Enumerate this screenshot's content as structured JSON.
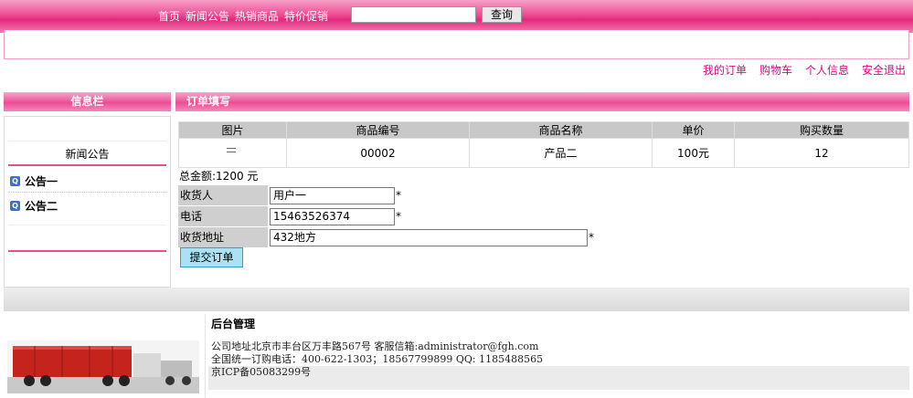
{
  "nav": {
    "items": [
      "首页",
      "新闻公告",
      "热销商品",
      "特价促销"
    ],
    "search_placeholder": "",
    "search_button": "查询"
  },
  "user_links": [
    "我的订单",
    "购物车",
    "个人信息",
    "安全退出"
  ],
  "sidebar": {
    "title": "信息栏",
    "news_tab": "新闻公告",
    "notices": [
      "公告一",
      "公告二"
    ]
  },
  "main": {
    "title": "订单填写",
    "table": {
      "headers": [
        "图片",
        "商品编号",
        "商品名称",
        "单价",
        "购买数量"
      ],
      "rows": [
        {
          "image": "",
          "code": "00002",
          "name": "产品二",
          "price": "100元",
          "qty": "12"
        }
      ]
    },
    "total": "总金额:1200 元",
    "form": {
      "receiver_label": "收货人",
      "receiver_value": "用户一",
      "phone_label": "电话",
      "phone_value": "15463526374",
      "address_label": "收货地址",
      "address_value": "432地方",
      "required_mark": "*"
    },
    "submit_label": "提交订单"
  },
  "footer": {
    "title": "后台管理",
    "address": "公司地址北京市丰台区万丰路567号  客服信箱:administrator@fgh.com",
    "phone": "全国统一订购电话：400-622-1303；18567799899  QQ: 1185488565",
    "icp": "京ICP备05083299号"
  },
  "colors": {
    "brand_pink": "#e4287c",
    "link_pink": "#e4007f",
    "button_blue": "#a9e2f5"
  }
}
